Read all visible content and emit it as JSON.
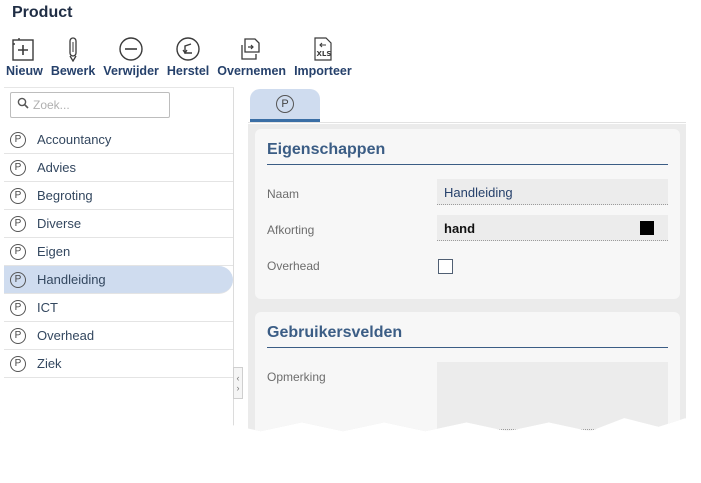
{
  "window": {
    "title": "Product"
  },
  "toolbar": {
    "buttons": [
      {
        "label": "Nieuw",
        "icon": "new-icon"
      },
      {
        "label": "Bewerk",
        "icon": "pencil-icon"
      },
      {
        "label": "Verwijder",
        "icon": "minus-circle-icon"
      },
      {
        "label": "Herstel",
        "icon": "undo-circle-icon"
      },
      {
        "label": "Overnemen",
        "icon": "copy-icon"
      },
      {
        "label": "Importeer",
        "icon": "xls-import-icon"
      }
    ],
    "xls_text": "XLS"
  },
  "search": {
    "placeholder": "Zoek..."
  },
  "list": {
    "icon_letter": "P",
    "items": [
      "Accountancy",
      "Advies",
      "Begroting",
      "Diverse",
      "Eigen",
      "Handleiding",
      "ICT",
      "Overhead",
      "Ziek"
    ],
    "selected": "Handleiding"
  },
  "tab": {
    "icon_letter": "P"
  },
  "properties": {
    "title": "Eigenschappen",
    "name_label": "Naam",
    "name_value": "Handleiding",
    "abbr_label": "Afkorting",
    "abbr_value": "hand",
    "abbr_color": "#000000",
    "overhead_label": "Overhead",
    "overhead_checked": false
  },
  "user_fields": {
    "title": "Gebruikersvelden",
    "remark_label": "Opmerking",
    "remark_value": ""
  },
  "colors": {
    "accent": "#3b5d85",
    "selected_bg": "#cfdcef"
  }
}
